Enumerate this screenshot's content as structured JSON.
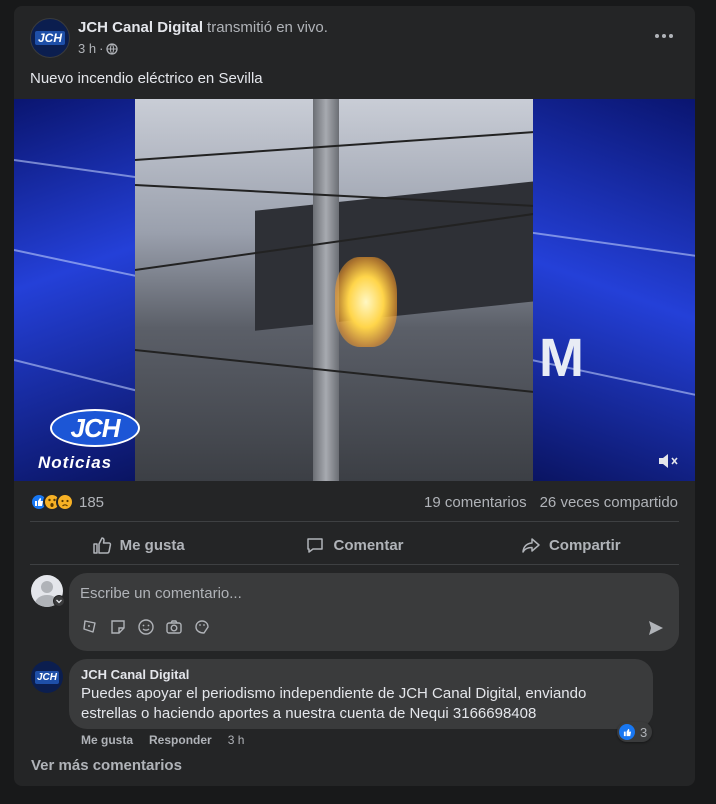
{
  "post": {
    "page_name": "JCH Canal Digital",
    "action": "transmitió en vivo.",
    "time": "3 h",
    "avatar_text": "JCH",
    "caption": "Nuevo incendio eléctrico en Sevilla",
    "video": {
      "brand_logo": "JCH",
      "brand_sub": "Noticias",
      "overlay_letter": "M"
    },
    "reactions": {
      "icons": [
        "like-icon",
        "wow-icon",
        "sad-icon"
      ],
      "count": "185"
    },
    "stats": {
      "comments": "19 comentarios",
      "shares": "26 veces compartido"
    },
    "actions": {
      "like": "Me gusta",
      "comment": "Comentar",
      "share": "Compartir"
    },
    "composer": {
      "placeholder": "Escribe un comentario..."
    },
    "comment": {
      "author": "JCH Canal Digital",
      "avatar_text": "JCH",
      "text": "Puedes apoyar el periodismo independiente de JCH Canal Digital, enviando estrellas o haciendo aportes a nuestra cuenta de Nequi 3166698408",
      "reaction_count": "3",
      "like_label": "Me gusta",
      "reply_label": "Responder",
      "time": "3 h"
    },
    "more_comments": "Ver más comentarios"
  },
  "colors": {
    "background": "#18191a",
    "card": "#242526",
    "bubble": "#3a3b3c",
    "accent": "#1877f2",
    "text_primary": "#e4e6eb",
    "text_secondary": "#b0b3b8"
  }
}
